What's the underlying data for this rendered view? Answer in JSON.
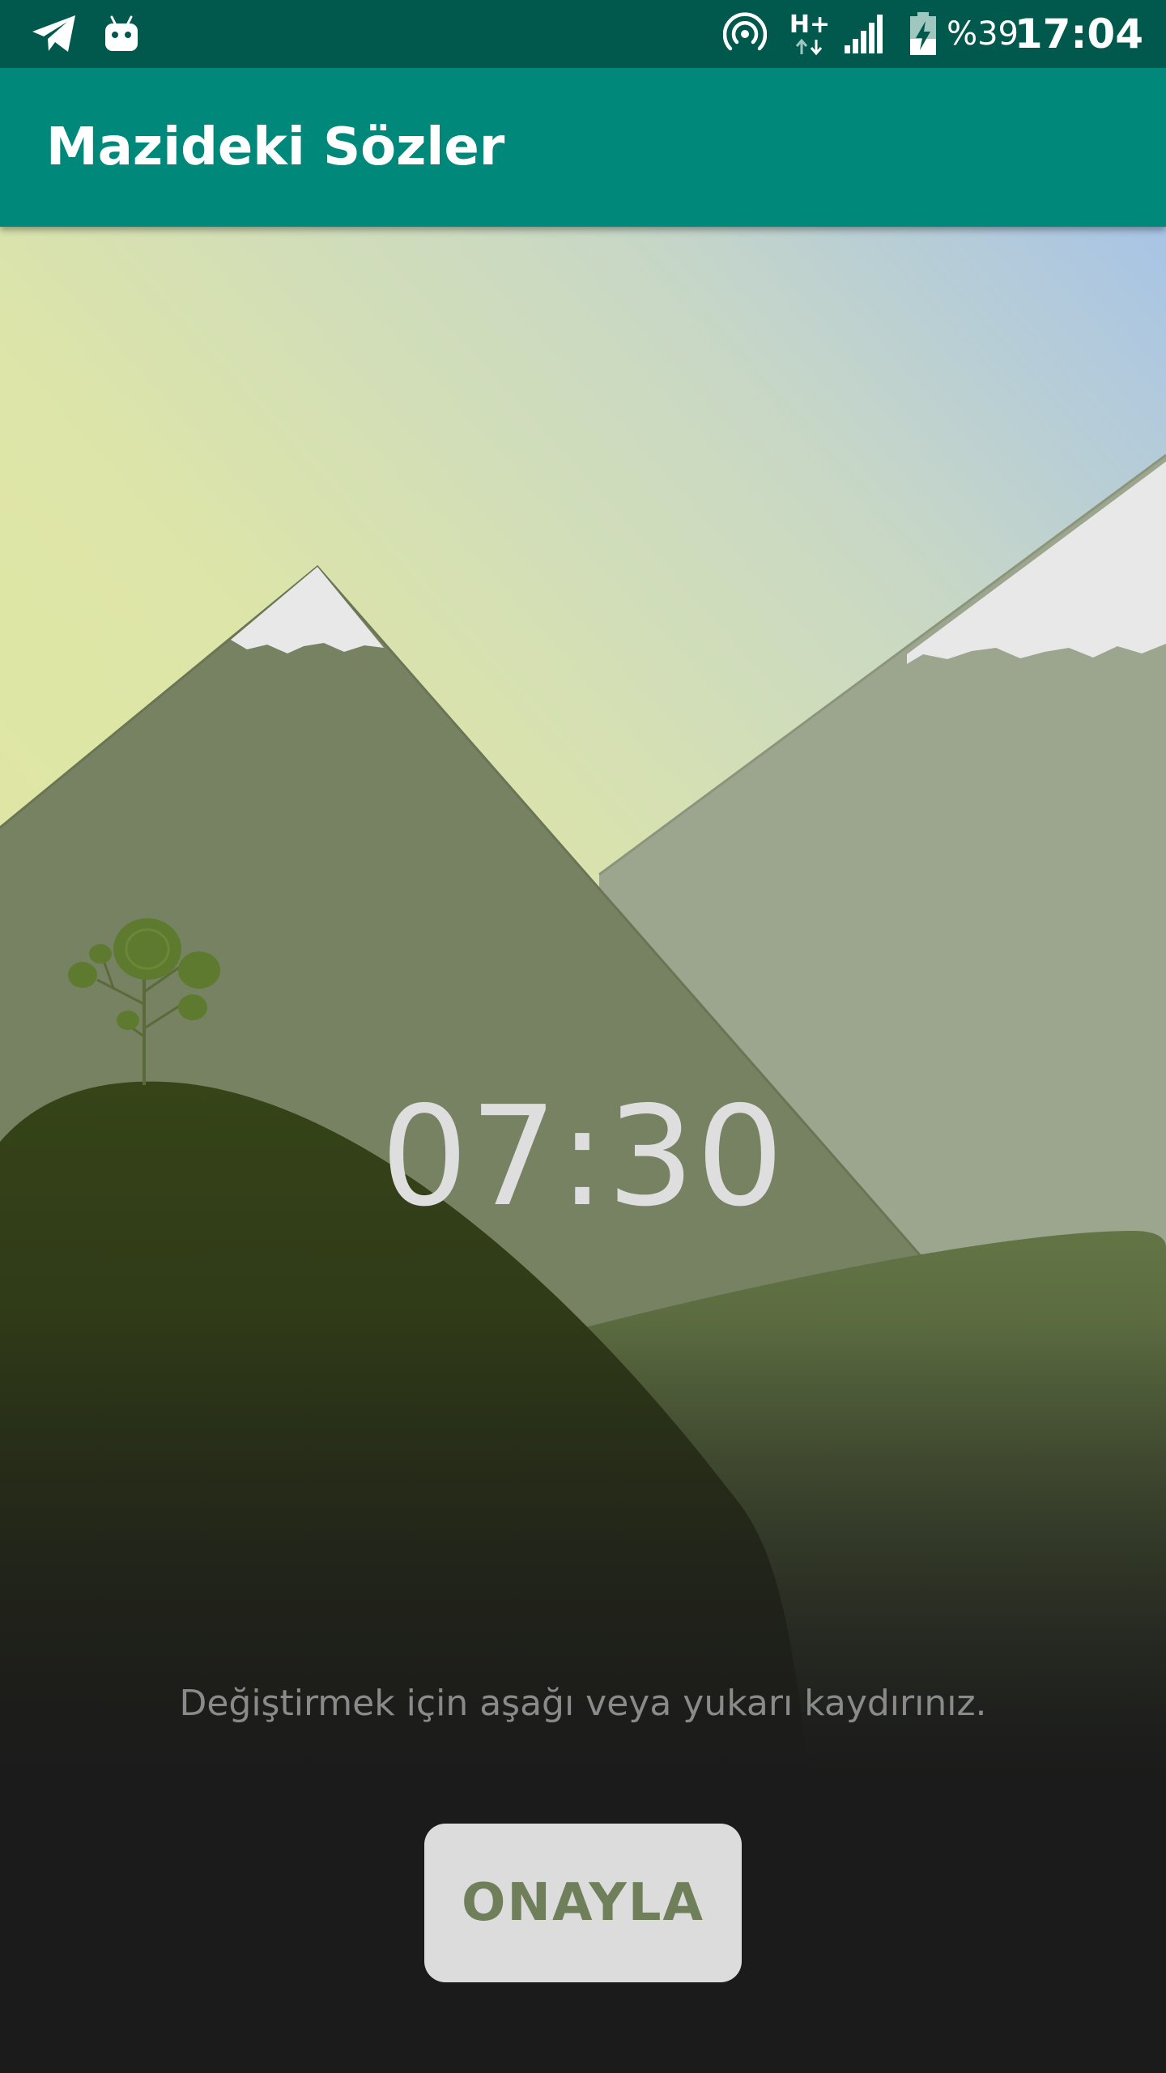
{
  "status_bar": {
    "icons": [
      "telegram-icon",
      "android-icon",
      "hotspot-icon",
      "network-type-icon",
      "signal-icon",
      "battery-charging-icon"
    ],
    "network_type": "H+",
    "battery_percent": "%39",
    "time": "17:04",
    "background_color": "#00594c"
  },
  "app_bar": {
    "title": "Mazideki Sözler",
    "background_color": "#00897b"
  },
  "alarm": {
    "time": "07:30",
    "hint": "Değiştirmek için aşağı veya yukarı kaydırınız.",
    "confirm_label": "ONAYLA"
  },
  "colors": {
    "time_text": "#dedede",
    "button_bg": "#dcdcdc",
    "button_text": "#6f7f5a",
    "page_bg": "#1b1b1b"
  }
}
